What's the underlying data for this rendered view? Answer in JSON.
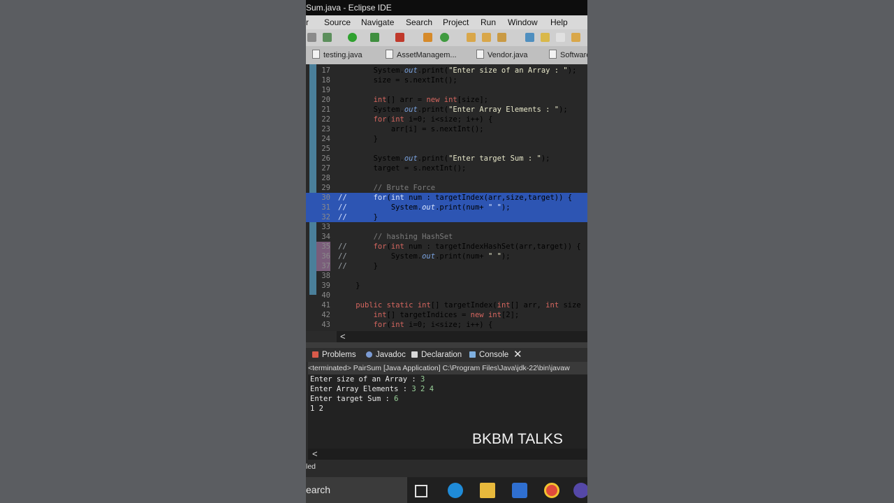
{
  "window": {
    "title": "Sum.java - Eclipse IDE"
  },
  "menu": [
    "r",
    "Source",
    "Navigate",
    "Search",
    "Project",
    "Run",
    "Window",
    "Help"
  ],
  "editor_tabs": [
    "testing.java",
    "AssetManagem...",
    "Vendor.java",
    "Software"
  ],
  "code_lines": [
    {
      "num": "17",
      "code": "        System.out.print(\"Enter size of an Array : \");"
    },
    {
      "num": "18",
      "code": "        size = s.nextInt();"
    },
    {
      "num": "19",
      "code": ""
    },
    {
      "num": "20",
      "code": "        int[] arr = new int[size];"
    },
    {
      "num": "21",
      "code": "        System.out.print(\"Enter Array Elements : \");"
    },
    {
      "num": "22",
      "code": "        for(int i=0; i<size; i++) {"
    },
    {
      "num": "23",
      "code": "            arr[i] = s.nextInt();"
    },
    {
      "num": "24",
      "code": "        }"
    },
    {
      "num": "25",
      "code": ""
    },
    {
      "num": "26",
      "code": "        System.out.print(\"Enter target Sum : \");"
    },
    {
      "num": "27",
      "code": "        target = s.nextInt();"
    },
    {
      "num": "28",
      "code": ""
    },
    {
      "num": "29",
      "code": "        // Brute Force"
    },
    {
      "num": "30",
      "comment": "//",
      "code": "        for(int num : targetIndex(arr,size,target)) {"
    },
    {
      "num": "31",
      "comment": "//",
      "code": "            System.out.print(num+ \" \");"
    },
    {
      "num": "32",
      "comment": "//",
      "code": "        }"
    },
    {
      "num": "33",
      "code": ""
    },
    {
      "num": "34",
      "code": "        // hashing HashSet"
    },
    {
      "num": "35",
      "comment": "//",
      "code": "        for(int num : targetIndexHashSet(arr,target)) {"
    },
    {
      "num": "36",
      "comment": "//",
      "code": "            System.out.print(num+ \" \");"
    },
    {
      "num": "37",
      "comment": "//",
      "code": "        }"
    },
    {
      "num": "38",
      "code": ""
    },
    {
      "num": "39",
      "code": "    }"
    },
    {
      "num": "40",
      "code": ""
    },
    {
      "num": "41",
      "code": "    public static int[] targetIndex(int[] arr, int size"
    },
    {
      "num": "42",
      "code": "        int[] targetIndices = new int[2];"
    },
    {
      "num": "43",
      "code": "        for(int i=0; i<size; i++) {"
    }
  ],
  "view_tabs": [
    "Problems",
    "Javadoc",
    "Declaration",
    "Console"
  ],
  "console": {
    "header": "<terminated> PairSum [Java Application] C:\\Program Files\\Java\\jdk-22\\bin\\javaw",
    "lines": [
      {
        "prompt": "Enter size of an Array : ",
        "input": "3"
      },
      {
        "prompt": "Enter Array Elements : ",
        "input": "3 2 4"
      },
      {
        "prompt": "Enter target Sum : ",
        "input": "6"
      },
      {
        "prompt": "1 2",
        "input": ""
      }
    ]
  },
  "scroll_left_glyph": "<",
  "status_text": "led",
  "taskbar": {
    "search_label": "earch"
  },
  "watermark": "BKBM TALKS"
}
